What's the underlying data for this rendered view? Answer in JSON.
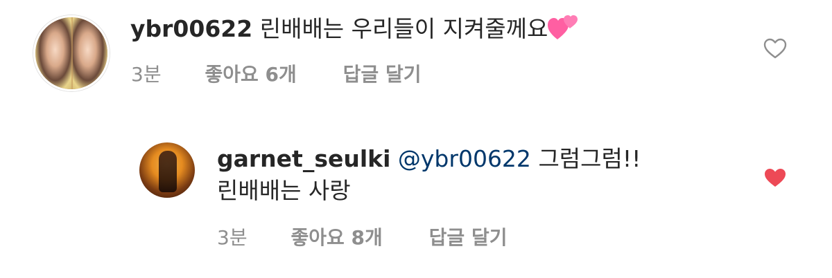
{
  "comments": [
    {
      "username": "ybr00622",
      "text": "린배배는 우리들이 지켜줄께요",
      "emoji": "two-hearts-emoji",
      "time": "3분",
      "likes": "좋아요 6개",
      "reply": "답글 달기",
      "liked": false
    },
    {
      "username": "garnet_seulki",
      "mention": "@ybr00622",
      "text_line1": "그럼그럼!!",
      "text_line2": "린배배는 사랑",
      "time": "3분",
      "likes": "좋아요 8개",
      "reply": "답글 달기",
      "liked": true
    }
  ],
  "colors": {
    "username": "#262626",
    "mention": "#00376b",
    "meta": "#8e8e8e",
    "liked_heart": "#ed4956",
    "heart_outline": "#8e8e8e"
  },
  "icons": {
    "heart_outline": "heart-outline-icon",
    "heart_filled": "heart-filled-icon"
  }
}
